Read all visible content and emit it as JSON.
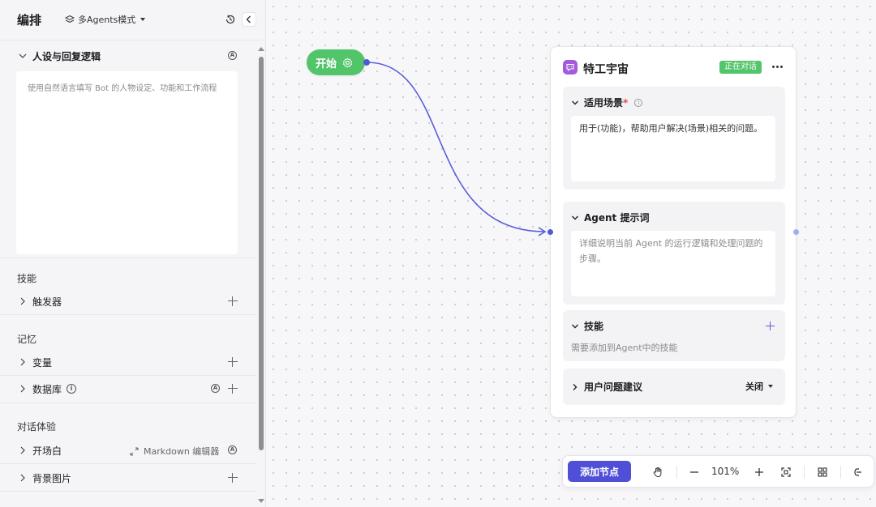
{
  "left_panel": {
    "title": "编排",
    "mode_selector": "多Agents模式",
    "persona": {
      "label": "人设与回复逻辑",
      "placeholder": "使用自然语言填写 Bot 的人物设定、功能和工作流程"
    },
    "skills_section": {
      "title": "技能",
      "items": [
        {
          "label": "触发器"
        }
      ]
    },
    "memory_section": {
      "title": "记忆",
      "items": [
        {
          "label": "变量"
        },
        {
          "label": "数据库"
        }
      ]
    },
    "dialog_section": {
      "title": "对话体验",
      "items": [
        {
          "label": "开场白",
          "action": "Markdown 编辑器"
        },
        {
          "label": "背景图片"
        }
      ]
    }
  },
  "canvas": {
    "start_node": {
      "label": "开始"
    },
    "agent_node": {
      "title": "特工宇宙",
      "status": "正在对话",
      "scenario": {
        "label": "适用场景",
        "required_mark": "*",
        "value": "用于(功能)，帮助用户解决(场景)相关的问题。"
      },
      "prompt": {
        "label": "Agent 提示词",
        "placeholder": "详细说明当前 Agent 的运行逻辑和处理问题的步骤。"
      },
      "skills": {
        "label": "技能",
        "hint": "需要添加到Agent中的技能"
      },
      "suggestions": {
        "label": "用户问题建议",
        "value": "关闭"
      }
    }
  },
  "toolbar": {
    "add_node": "添加节点",
    "zoom": "101%"
  },
  "colors": {
    "accent": "#4f4fd8",
    "start_green": "#52c46a",
    "edge": "#5b5fd6",
    "agent_icon": "#a35bdc"
  }
}
